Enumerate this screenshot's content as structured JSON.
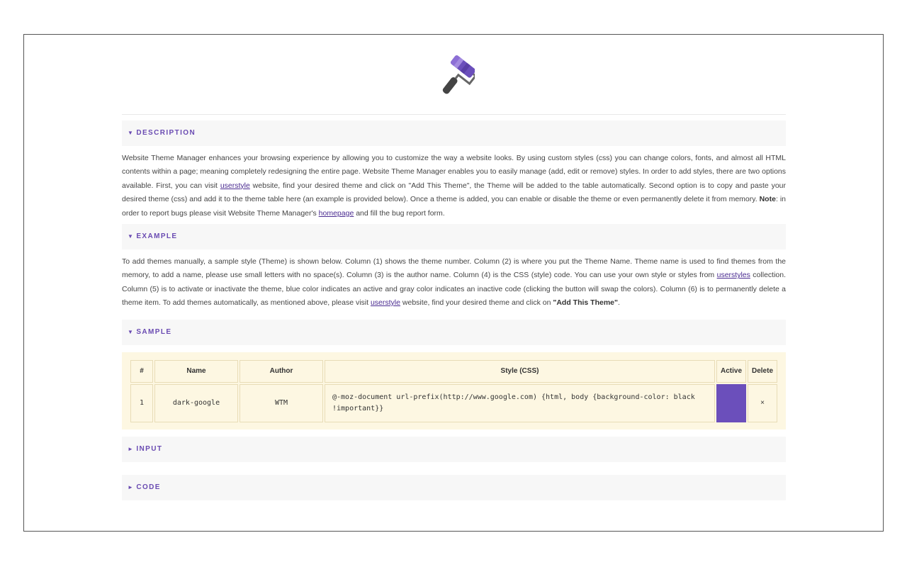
{
  "sections": {
    "description": {
      "arrow": "▼",
      "title": "DESCRIPTION",
      "p1": "Website Theme Manager enhances your browsing experience by allowing you to customize the way a website looks. By using custom styles (css) you can change colors, fonts, and almost all HTML contents within a page; meaning completely redesigning the entire page. Website Theme Manager enables you to easily manage (add, edit or remove) styles. In order to add styles, there are two options available. First, you can visit ",
      "link1": "userstyle",
      "p2": " website, find your desired theme and click on \"Add This Theme\", the Theme will be added to the table automatically. Second option is to copy and paste your desired theme (css) and add it to the theme table here (an example is provided below). Once a theme is added, you can enable or disable the theme or even permanently delete it from memory. ",
      "note_label": "Note",
      "p3": ": in order to report bugs please visit Website Theme Manager's ",
      "link2": "homepage",
      "p4": " and fill the bug report form."
    },
    "example": {
      "arrow": "▼",
      "title": "EXAMPLE",
      "p1": "To add themes manually, a sample style (Theme) is shown below. Column (1) shows the theme number. Column (2) is where you put the Theme Name. Theme name is used to find themes from the memory, to add a name, please use small letters with no space(s). Column (3) is the author name. Column (4) is the CSS (style) code. You can use your own style or styles from ",
      "link1": "userstyles",
      "p2": " collection. Column (5) is to activate or inactivate the theme, blue color indicates an active and gray color indicates an inactive code (clicking the button will swap the colors). Column (6) is to permanently delete a theme item. To add themes automatically, as mentioned above, please visit ",
      "link2": "userstyle",
      "p3": " website, find your desired theme and click on ",
      "bold": "\"Add This Theme\"",
      "p4": "."
    },
    "sample": {
      "arrow": "▼",
      "title": "SAMPLE"
    },
    "input": {
      "arrow": "►",
      "title": "INPUT"
    },
    "code": {
      "arrow": "►",
      "title": "CODE"
    }
  },
  "table": {
    "headers": {
      "num": "#",
      "name": "Name",
      "author": "Author",
      "style": "Style (CSS)",
      "active": "Active",
      "delete": "Delete"
    },
    "rows": [
      {
        "num": "1",
        "name": "dark-google",
        "author": "WTM",
        "style": "@-moz-document url-prefix(http://www.google.com) {html, body {background-color: black !important}}",
        "delete": "×"
      }
    ]
  },
  "colors": {
    "accent": "#6b4fbb",
    "section_bg": "#f7f7f7",
    "sample_bg": "#fdf7e2"
  },
  "icons": {
    "logo": "paint-roller-icon"
  }
}
